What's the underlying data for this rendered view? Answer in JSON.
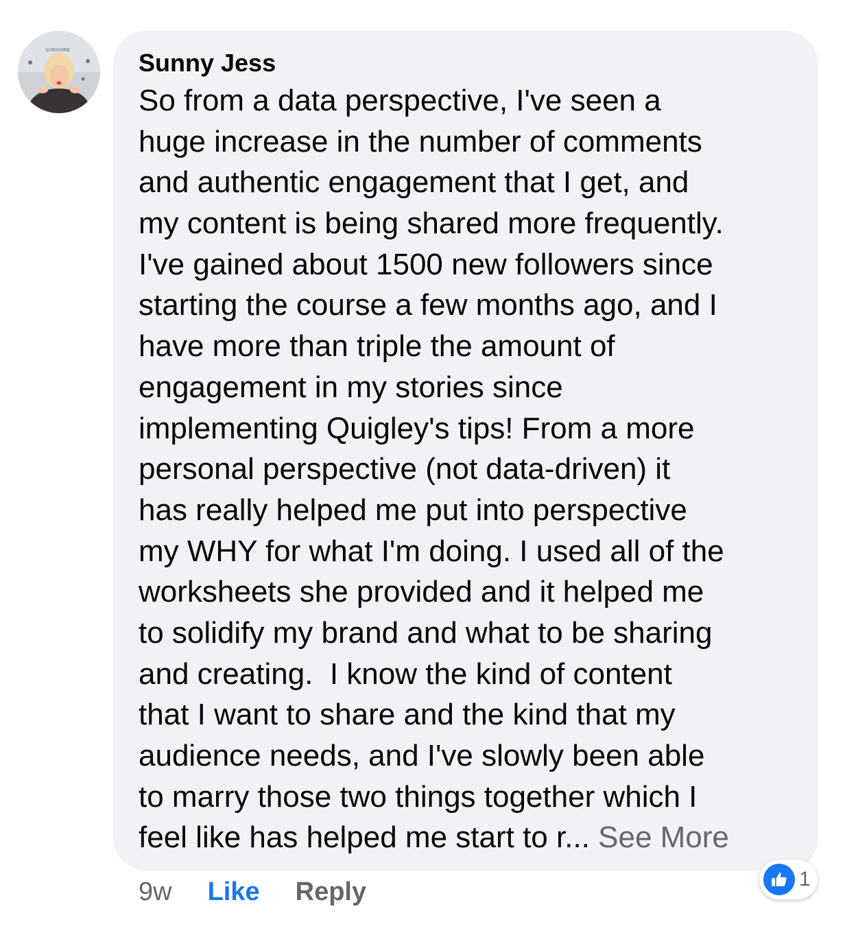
{
  "comment": {
    "author": "Sunny Jess",
    "lines": [
      "So from a data perspective, I've seen a",
      "huge increase in the number of comments",
      "and authentic engagement that I get, and",
      "my content is being shared more frequently.",
      "I've gained about 1500 new followers since",
      "starting the course a few months ago, and I",
      "have more than triple the amount of",
      "engagement in my stories since",
      "implementing Quigley's tips! From a more",
      "personal perspective (not data-driven) it",
      "has really helped me put into perspective",
      "my WHY for what I'm doing. I used all of the",
      "worksheets she provided and it helped me",
      "to solidify my brand and what to be sharing",
      "and creating.  I know the kind of content",
      "that I want to share and the kind that my",
      "audience needs, and I've slowly been able",
      "to marry those two things together which I",
      "feel like has helped me start to r... "
    ],
    "see_more_label": "See More",
    "avatar_sign_text": "SUNSHINE"
  },
  "actions": {
    "time": "9w",
    "like_label": "Like",
    "reply_label": "Reply"
  },
  "reactions": {
    "icon": "thumbs-up-icon",
    "count": "1"
  },
  "colors": {
    "bubble": "#f0f2f5",
    "text": "#050505",
    "secondary": "#65676b",
    "like_blue": "#1877f2"
  }
}
